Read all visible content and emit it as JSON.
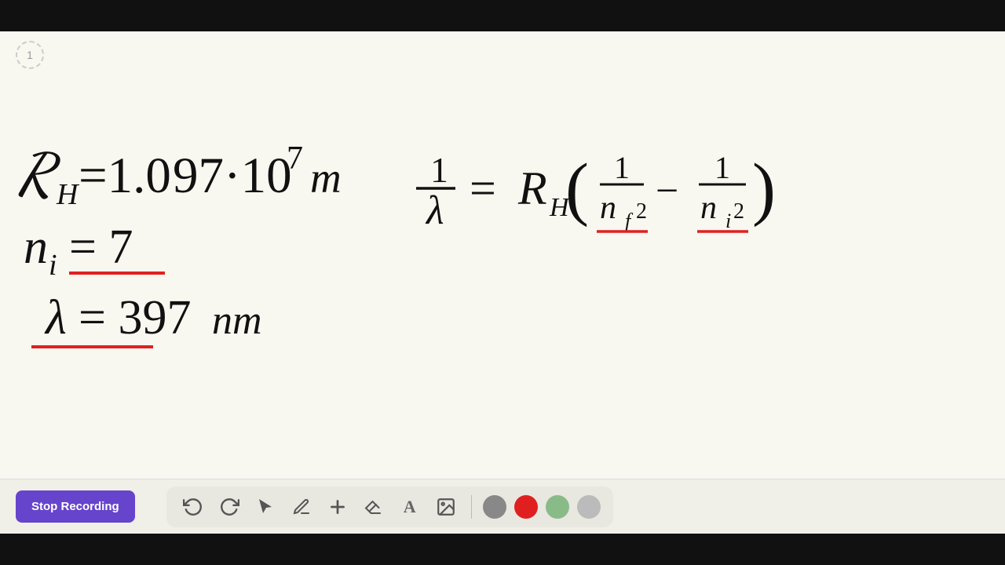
{
  "ui": {
    "page_number": "1",
    "stop_recording_label": "Stop Recording",
    "toolbar": {
      "tools": [
        {
          "name": "undo",
          "icon": "↺",
          "label": "Undo"
        },
        {
          "name": "redo",
          "icon": "↻",
          "label": "Redo"
        },
        {
          "name": "select",
          "icon": "↖",
          "label": "Select"
        },
        {
          "name": "pen",
          "icon": "✏",
          "label": "Pen"
        },
        {
          "name": "add",
          "icon": "+",
          "label": "Add"
        },
        {
          "name": "eraser",
          "icon": "⌫",
          "label": "Eraser"
        },
        {
          "name": "text",
          "icon": "A",
          "label": "Text"
        },
        {
          "name": "image",
          "icon": "🖼",
          "label": "Image"
        }
      ],
      "colors": [
        {
          "name": "gray",
          "value": "#888888"
        },
        {
          "name": "red",
          "value": "#e02020"
        },
        {
          "name": "green",
          "value": "#88bb88"
        },
        {
          "name": "light-gray",
          "value": "#bbbbbb"
        }
      ]
    },
    "colors": {
      "stop_btn_bg": "#6644cc",
      "canvas_bg": "#f8f7f0",
      "toolbar_bg": "#e8e7e0"
    }
  }
}
